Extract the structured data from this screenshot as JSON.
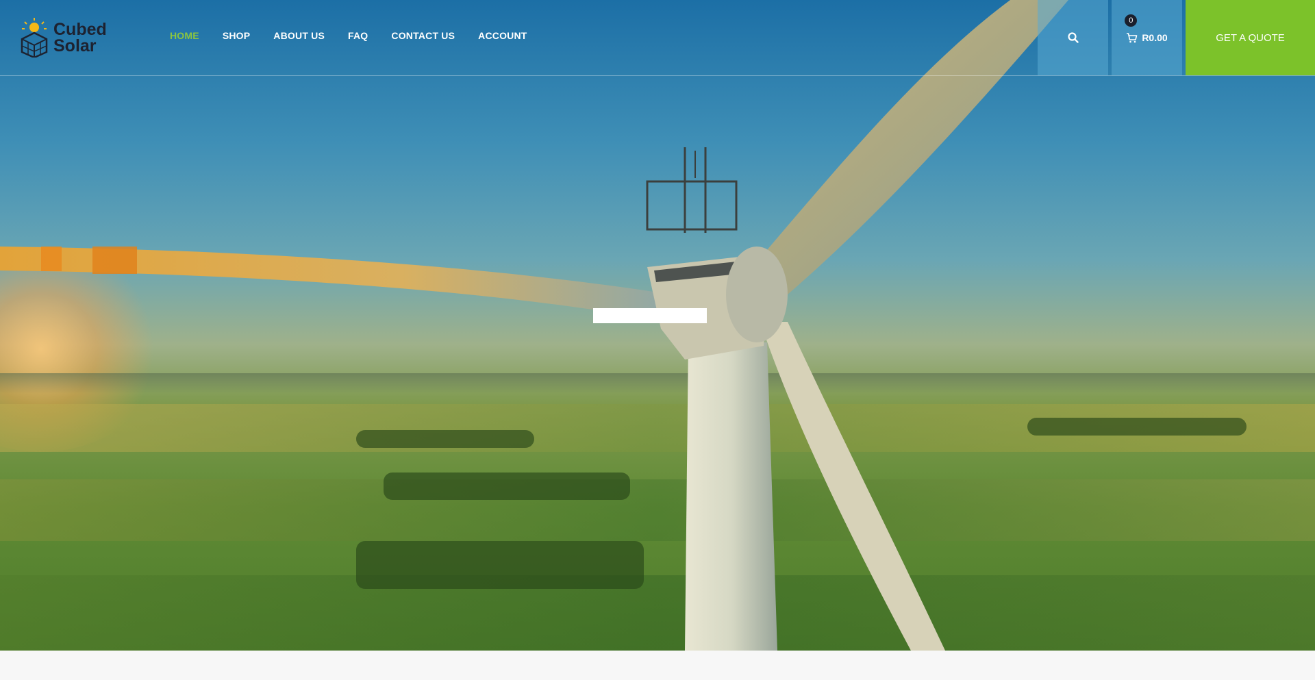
{
  "brand": {
    "line1": "Cubed",
    "line2": "Solar"
  },
  "nav": {
    "items": [
      {
        "label": "HOME",
        "active": true
      },
      {
        "label": "SHOP",
        "active": false
      },
      {
        "label": "ABOUT US",
        "active": false
      },
      {
        "label": "FAQ",
        "active": false
      },
      {
        "label": "CONTACT US",
        "active": false
      },
      {
        "label": "ACCOUNT",
        "active": false
      }
    ]
  },
  "header": {
    "search_icon": "search-icon",
    "cart_icon": "cart-icon",
    "cart_count": "0",
    "cart_total": "R0.00",
    "quote_label": "GET A QUOTE"
  },
  "colors": {
    "accent_green": "#7cc22a",
    "nav_active": "#8cc63f",
    "brand_dark": "#1d2230"
  }
}
